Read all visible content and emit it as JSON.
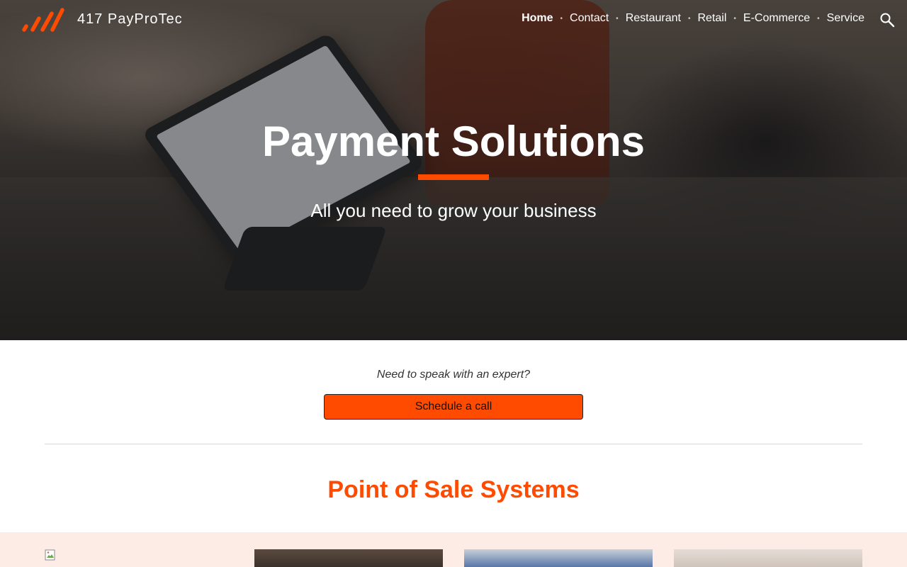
{
  "header": {
    "site_title": "417 PayProTec",
    "nav": [
      {
        "label": "Home",
        "active": true
      },
      {
        "label": "Contact"
      },
      {
        "label": "Restaurant"
      },
      {
        "label": "Retail"
      },
      {
        "label": "E-Commerce"
      },
      {
        "label": "Service"
      }
    ],
    "search_icon": "search-icon"
  },
  "hero": {
    "title": "Payment Solutions",
    "subtitle": "All you need to grow your business"
  },
  "cta": {
    "prompt": "Need to speak with an expert?",
    "button_label": "Schedule a call"
  },
  "section": {
    "title": "Point of Sale Systems"
  },
  "colors": {
    "accent": "#ff4b00",
    "band": "#fdece5"
  }
}
